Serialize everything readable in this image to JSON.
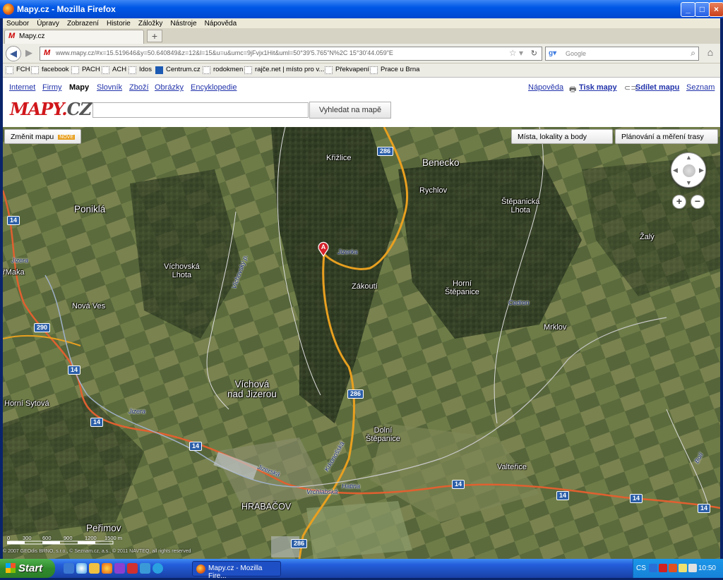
{
  "window": {
    "title": "Mapy.cz - Mozilla Firefox"
  },
  "menu": [
    "Soubor",
    "Úpravy",
    "Zobrazení",
    "Historie",
    "Záložky",
    "Nástroje",
    "Nápověda"
  ],
  "tab": {
    "title": "Mapy.cz"
  },
  "url": "www.mapy.cz/#x=15.519646&y=50.640849&z=12&l=15&u=u&umc=9jFvjx1Hit&uml=50°39'5.765\"N%2C 15°30'44.059\"E",
  "search": {
    "placeholder": "Google"
  },
  "bookmarks": [
    "FCH",
    "facebook",
    "PACH",
    "ACH",
    "Idos",
    "Centrum.cz",
    "rodokmen",
    "rajče.net | místo pro v...",
    "Překvapení",
    "Prace u Brna"
  ],
  "services": [
    "Internet",
    "Firmy",
    "Mapy",
    "Slovník",
    "Zboží",
    "Obrázky",
    "Encyklopedie"
  ],
  "right_links": {
    "help": "Nápověda",
    "print": "Tisk mapy",
    "share": "Sdílet mapu",
    "seznam": "Seznam"
  },
  "logo": {
    "main": "MAPY.",
    "cz": "CZ"
  },
  "search_button": "Vyhledat na mapě",
  "map": {
    "change_map": "Změnit mapu",
    "nove": "NOVÉ",
    "places_button": "Místa, lokality a body",
    "planning_button": "Plánování a měření trasy",
    "marker": "A",
    "places": {
      "krizlice": "Křižlice",
      "benecko": "Benecko",
      "rychlov": "Rychlov",
      "stepanicka_lhota": "Štěpanická\nLhota",
      "ponikla": "Poniklá",
      "zaly": "Žalý",
      "vichovska_lhota": "Víchovská\nLhota",
      "zakouti": "Zákoutí",
      "horni_stepanice": "Horní\nŠtěpanice",
      "fmaka": "řMaka",
      "nova_ves": "Nová Ves",
      "mrklov": "Mrklov",
      "vichova": "Víchová\nnad Jizerou",
      "horni_sytova": "Horní Sytová",
      "dolni_stepanice": "Dolní\nŠtěpanice",
      "valterice": "Valteřice",
      "hrabacov": "HRABAČOV",
      "perimov": "Peřimov"
    },
    "rivers": {
      "jizerka": "Jizerka",
      "cedron": "Cedron",
      "jizera1": "Jizera",
      "jizera2": "Jizera",
      "vichovsky": "Víchovský p.",
      "jizerska": "Jizerská",
      "krkonosska": "Krkonošská",
      "vrchlabska": "Vrchlabská",
      "hatina": "Hatina",
      "bolt": "Bolí"
    },
    "roads": {
      "r286a": "286",
      "r286b": "286",
      "r286c": "286",
      "r14a": "14",
      "r14b": "14",
      "r14c": "14",
      "r14d": "14",
      "r14e": "14",
      "r14f": "14",
      "r290": "290"
    },
    "scale": [
      "0",
      "300",
      "600",
      "900",
      "1200",
      "1500 m"
    ],
    "copyright": "© 2007 GEOdis BRNO, s.r.o., © Seznam.cz, a.s., © 2011 NAVTEQ, all rights reserved",
    "colors": {
      "route": "#e8a020",
      "highway": "#e06030",
      "marker": "#d4202a"
    }
  },
  "taskbar": {
    "start": "Start",
    "item": "Mapy.cz - Mozilla Fire...",
    "lang": "CS",
    "time": "10:50"
  }
}
